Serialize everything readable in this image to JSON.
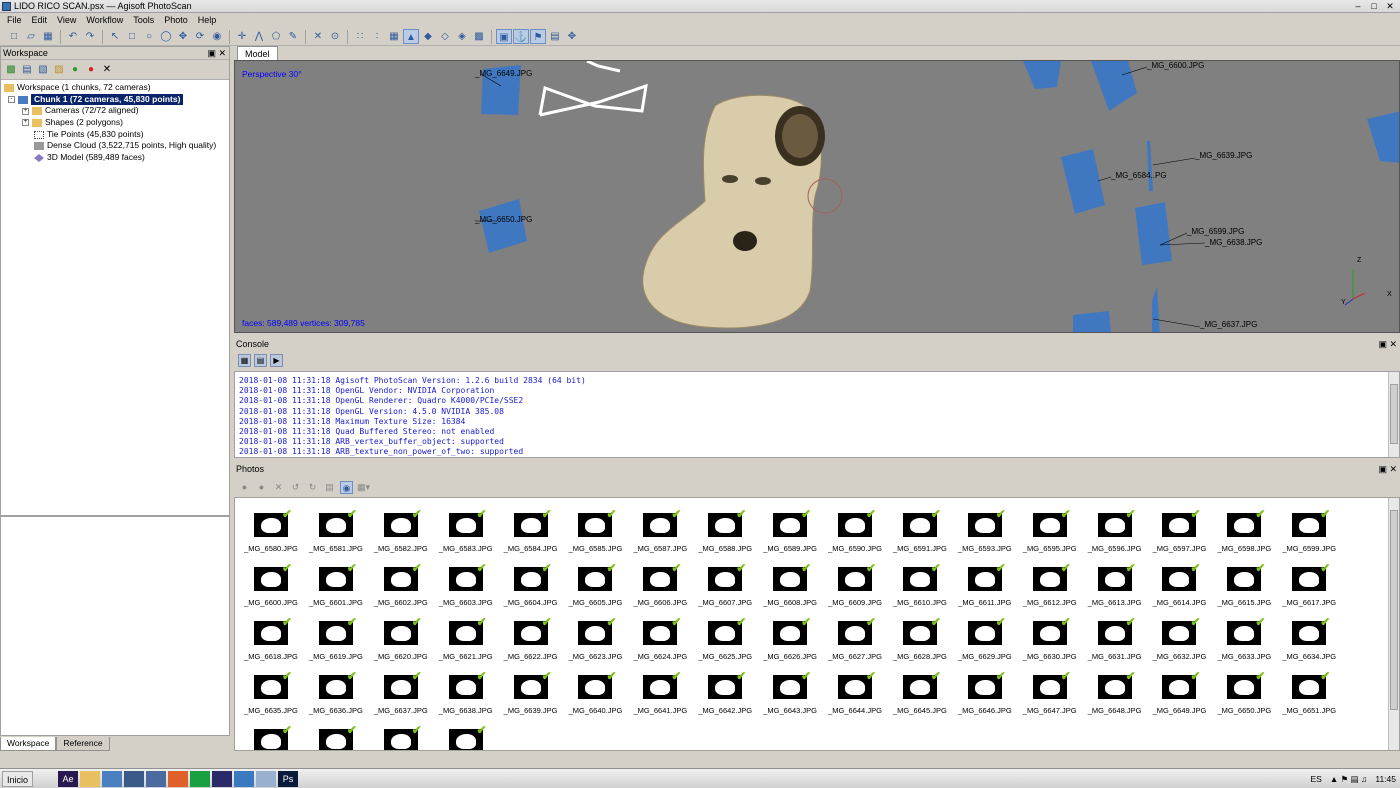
{
  "window": {
    "title": "LIDO RICO SCAN.psx — Agisoft PhotoScan"
  },
  "menu": [
    "File",
    "Edit",
    "View",
    "Workflow",
    "Tools",
    "Photo",
    "Help"
  ],
  "workspace": {
    "title": "Workspace",
    "root": "Workspace (1 chunks, 72 cameras)",
    "chunk": "Chunk 1 (72 cameras, 45,830 points)",
    "items": [
      "Cameras (72/72 aligned)",
      "Shapes (2 polygons)",
      "Tie Points (45,830 points)",
      "Dense Cloud (3,522,715 points, High quality)",
      "3D Model (589,489 faces)"
    ]
  },
  "bottom_tabs": [
    "Workspace",
    "Reference"
  ],
  "model": {
    "tab": "Model",
    "perspective": "Perspective 30°",
    "stats": "faces: 589,489 vertices: 309,785",
    "camera_labels": [
      "_MG_6649.JPG",
      "_MG_6650.JPG",
      "_MG_6600.JPG",
      "_MG_6639.JPG",
      "_MG_6584..PG",
      "_MG_6599.JPG",
      "_MG_6638.JPG",
      "_MG_6637.JPG"
    ],
    "axis": {
      "z": "Z",
      "y": "Y",
      "x": "X"
    }
  },
  "console": {
    "title": "Console",
    "lines": [
      "2018-01-08 11:31:18 Agisoft PhotoScan Version: 1.2.6 build 2834 (64 bit)",
      "2018-01-08 11:31:18 OpenGL Vendor: NVIDIA Corporation",
      "2018-01-08 11:31:18 OpenGL Renderer: Quadro K4000/PCIe/SSE2",
      "2018-01-08 11:31:18 OpenGL Version: 4.5.0 NVIDIA 385.08",
      "2018-01-08 11:31:18 Maximum Texture Size: 16384",
      "2018-01-08 11:31:18 Quad Buffered Stereo: not enabled",
      "2018-01-08 11:31:18 ARB_vertex_buffer_object: supported",
      "2018-01-08 11:31:18 ARB_texture_non_power_of_two: supported"
    ]
  },
  "photos": {
    "title": "Photos",
    "items": [
      "_MG_6580.JPG",
      "_MG_6581.JPG",
      "_MG_6582.JPG",
      "_MG_6583.JPG",
      "_MG_6584.JPG",
      "_MG_6585.JPG",
      "_MG_6587.JPG",
      "_MG_6588.JPG",
      "_MG_6589.JPG",
      "_MG_6590.JPG",
      "_MG_6591.JPG",
      "_MG_6593.JPG",
      "_MG_6595.JPG",
      "_MG_6596.JPG",
      "_MG_6597.JPG",
      "_MG_6598.JPG",
      "_MG_6599.JPG",
      "_MG_6600.JPG",
      "_MG_6601.JPG",
      "_MG_6602.JPG",
      "_MG_6603.JPG",
      "_MG_6604.JPG",
      "_MG_6605.JPG",
      "_MG_6606.JPG",
      "_MG_6607.JPG",
      "_MG_6608.JPG",
      "_MG_6609.JPG",
      "_MG_6610.JPG",
      "_MG_6611.JPG",
      "_MG_6612.JPG",
      "_MG_6613.JPG",
      "_MG_6614.JPG",
      "_MG_6615.JPG",
      "_MG_6617.JPG",
      "_MG_6618.JPG",
      "_MG_6619.JPG",
      "_MG_6620.JPG",
      "_MG_6621.JPG",
      "_MG_6622.JPG",
      "_MG_6623.JPG",
      "_MG_6624.JPG",
      "_MG_6625.JPG",
      "_MG_6626.JPG",
      "_MG_6627.JPG",
      "_MG_6628.JPG",
      "_MG_6629.JPG",
      "_MG_6630.JPG",
      "_MG_6631.JPG",
      "_MG_6632.JPG",
      "_MG_6633.JPG",
      "_MG_6634.JPG",
      "_MG_6635.JPG",
      "_MG_6636.JPG",
      "_MG_6637.JPG",
      "_MG_6638.JPG",
      "_MG_6639.JPG",
      "_MG_6640.JPG",
      "_MG_6641.JPG",
      "_MG_6642.JPG",
      "_MG_6643.JPG",
      "_MG_6644.JPG",
      "_MG_6645.JPG",
      "_MG_6646.JPG",
      "_MG_6647.JPG",
      "_MG_6648.JPG",
      "_MG_6649.JPG",
      "_MG_6650.JPG",
      "_MG_6651.JPG",
      "",
      "",
      "",
      ""
    ]
  },
  "taskbar": {
    "start": "Inicio",
    "lang": "ES",
    "time": "11:45"
  }
}
